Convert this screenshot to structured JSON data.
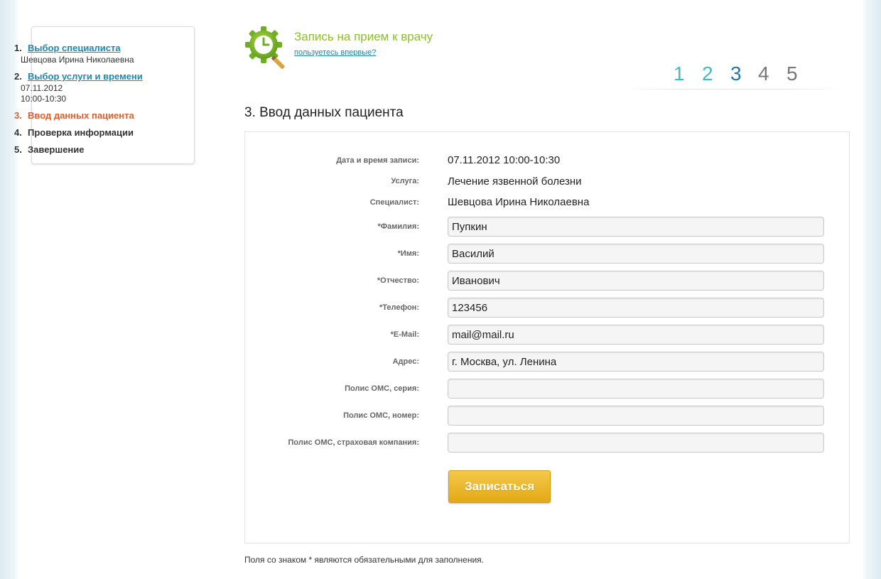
{
  "sidebar": {
    "steps": [
      {
        "num": "1.",
        "label": "Выбор специалиста",
        "sub": [
          "Шевцова Ирина Николаевна"
        ]
      },
      {
        "num": "2.",
        "label": "Выбор услуги и времени",
        "sub": [
          "07.11.2012",
          "10:00-10:30"
        ]
      },
      {
        "num": "3.",
        "label": "Ввод данных пациента"
      },
      {
        "num": "4.",
        "label": "Проверка информации"
      },
      {
        "num": "5.",
        "label": "Завершение"
      }
    ]
  },
  "header": {
    "title": "Запись на прием к врачу",
    "first_time_link": "пользуетесь впервые?",
    "stepper": [
      "1",
      "2",
      "3",
      "4",
      "5"
    ],
    "stepper_current": 3
  },
  "section_title": "3. Ввод данных пациента",
  "summary": {
    "datetime_label": "Дата и время записи:",
    "datetime_value": "07.11.2012 10:00-10:30",
    "service_label": "Услуга:",
    "service_value": "Лечение язвенной болезни",
    "specialist_label": "Специалист:",
    "specialist_value": "Шевцова Ирина Николаевна"
  },
  "form": {
    "lastname_label": "*Фамилия:",
    "lastname_value": "Пупкин",
    "firstname_label": "*Имя:",
    "firstname_value": "Василий",
    "patronymic_label": "*Отчество:",
    "patronymic_value": "Иванович",
    "phone_label": "*Телефон:",
    "phone_value": "123456",
    "email_label": "*E-Mail:",
    "email_value": "mail@mail.ru",
    "address_label": "Адрес:",
    "address_value": "г. Москва, ул. Ленина",
    "policy_series_label": "Полис ОМС, серия:",
    "policy_series_value": "",
    "policy_number_label": "Полис ОМС, номер:",
    "policy_number_value": "",
    "policy_company_label": "Полис ОМС, страховая компания:",
    "policy_company_value": "",
    "submit_label": "Записаться"
  },
  "footnote": "Поля со знаком * являются обязательными для заполнения.",
  "colors": {
    "link": "#1f87b0",
    "active_step": "#e05d2c",
    "title_green": "#8cbf2e",
    "stepper_done": "#3bbfbf",
    "stepper_current": "#1f78b4",
    "stepper_future": "#777777",
    "button": "#e9b21f"
  },
  "icons": {
    "logo": "clock-gear-icon"
  }
}
